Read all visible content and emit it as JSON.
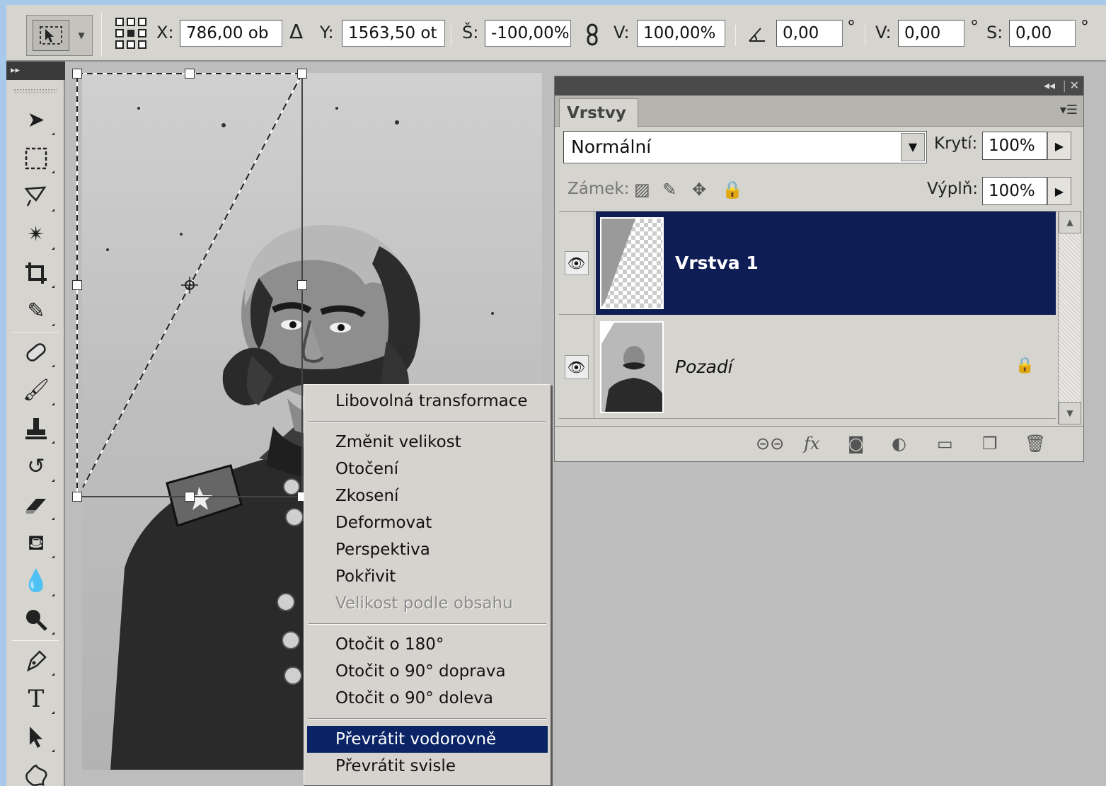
{
  "options_bar": {
    "x_label": "X:",
    "x_value": "786,00 ob",
    "delta_symbol": "Δ",
    "y_label": "Y:",
    "y_value": "1563,50 ot",
    "width_label": "Š:",
    "width_value": "-100,00%",
    "height_label": "V:",
    "height_value": "100,00%",
    "rotate_value": "0,00",
    "skew_h_label": "V:",
    "skew_h_value": "0,00",
    "skew_v_label": "S:",
    "skew_v_value": "0,00",
    "degree": "°"
  },
  "tools": [
    "move-tool",
    "marquee-tool",
    "lasso-tool",
    "magic-wand-tool",
    "crop-tool",
    "eyedropper-tool",
    "healing-brush-tool",
    "brush-tool",
    "clone-stamp-tool",
    "history-brush-tool",
    "eraser-tool",
    "paint-bucket-tool",
    "blur-tool",
    "dodge-tool",
    "pen-tool",
    "type-tool",
    "path-selection-tool",
    "custom-shape-tool"
  ],
  "context_menu": {
    "groups": [
      [
        {
          "label": "Libovolná transformace",
          "state": "normal"
        }
      ],
      [
        {
          "label": "Změnit velikost",
          "state": "normal"
        },
        {
          "label": "Otočení",
          "state": "normal"
        },
        {
          "label": "Zkosení",
          "state": "normal"
        },
        {
          "label": "Deformovat",
          "state": "normal"
        },
        {
          "label": "Perspektiva",
          "state": "normal"
        },
        {
          "label": "Pokřivit",
          "state": "normal"
        },
        {
          "label": "Velikost podle obsahu",
          "state": "disabled"
        }
      ],
      [
        {
          "label": "Otočit o 180°",
          "state": "normal"
        },
        {
          "label": "Otočit o 90° doprava",
          "state": "normal"
        },
        {
          "label": "Otočit o 90° doleva",
          "state": "normal"
        }
      ],
      [
        {
          "label": "Převrátit vodorovně",
          "state": "selected"
        },
        {
          "label": "Převrátit svisle",
          "state": "normal"
        }
      ]
    ]
  },
  "layers_panel": {
    "tab_label": "Vrstvy",
    "blend_mode": "Normální",
    "opacity_label": "Krytí:",
    "opacity_value": "100%",
    "lock_label": "Zámek:",
    "fill_label": "Výplň:",
    "fill_value": "100%",
    "layers": [
      {
        "name": "Vrstva 1",
        "selected": true,
        "locked": false
      },
      {
        "name": "Pozadí",
        "selected": false,
        "locked": true
      }
    ]
  },
  "colors": {
    "selection_blue": "#0a2466",
    "layer_selected_bg": "#0e1e55",
    "panel_gray": "#d6d4cf",
    "frame_blue": "#a9c9ea"
  }
}
